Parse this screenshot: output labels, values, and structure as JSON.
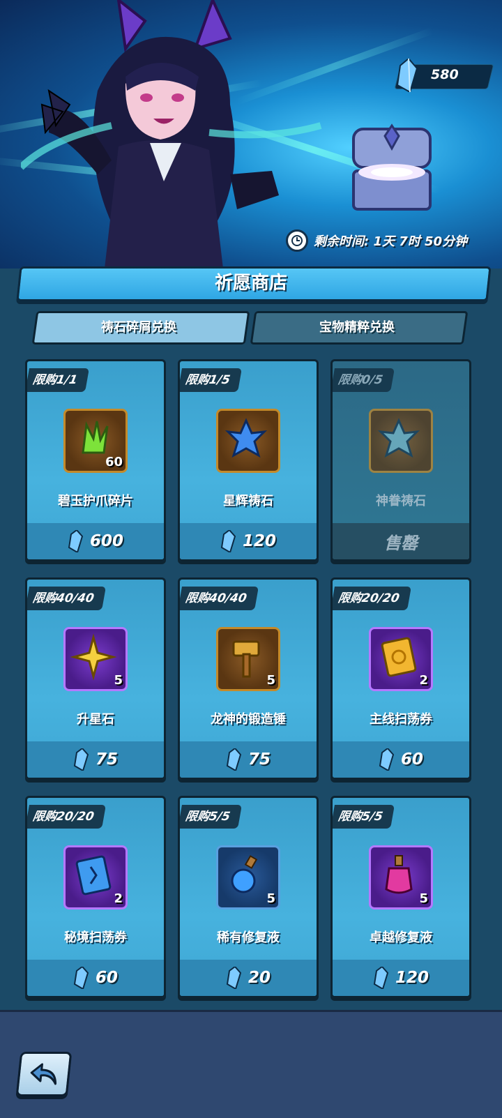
{
  "header": {
    "currency_amount": "580",
    "timer_text": "剩余时间: 1天 7时 50分钟"
  },
  "shop": {
    "title": "祈愿商店",
    "tabs": [
      {
        "label": "祷石碎屑兑换",
        "active": true
      },
      {
        "label": "宝物精粹兑换",
        "active": false
      }
    ],
    "items": [
      {
        "limit": "限购1/1",
        "name": "碧玉护爪碎片",
        "qty": "60",
        "price": "600",
        "icon": "jade-claw-fragment-icon",
        "frame": "gold"
      },
      {
        "limit": "限购1/5",
        "name": "星辉祷石",
        "qty": "",
        "price": "120",
        "icon": "starlight-stone-icon",
        "frame": "gold"
      },
      {
        "limit": "限购0/5",
        "name": "神眷祷石",
        "qty": "",
        "price": "",
        "sold_label": "售罄",
        "icon": "divine-stone-icon",
        "frame": "gold",
        "sold_out": true
      },
      {
        "limit": "限购40/40",
        "name": "升星石",
        "qty": "5",
        "price": "75",
        "icon": "star-up-stone-icon",
        "frame": "purple"
      },
      {
        "limit": "限购40/40",
        "name": "龙神的锻造锤",
        "qty": "5",
        "price": "75",
        "icon": "forging-hammer-icon",
        "frame": "gold"
      },
      {
        "limit": "限购20/20",
        "name": "主线扫荡券",
        "qty": "2",
        "price": "60",
        "icon": "main-sweep-ticket-icon",
        "frame": "purple"
      },
      {
        "limit": "限购20/20",
        "name": "秘境扫荡券",
        "qty": "2",
        "price": "60",
        "icon": "secret-sweep-ticket-icon",
        "frame": "purple"
      },
      {
        "limit": "限购5/5",
        "name": "稀有修复液",
        "qty": "5",
        "price": "20",
        "icon": "rare-potion-icon",
        "frame": "blue"
      },
      {
        "limit": "限购5/5",
        "name": "卓越修复液",
        "qty": "5",
        "price": "120",
        "icon": "epic-potion-icon",
        "frame": "purple"
      }
    ]
  },
  "colors": {
    "accent_blue": "#47b2de",
    "panel_dark": "#173a4f",
    "footer": "#2f4870"
  }
}
